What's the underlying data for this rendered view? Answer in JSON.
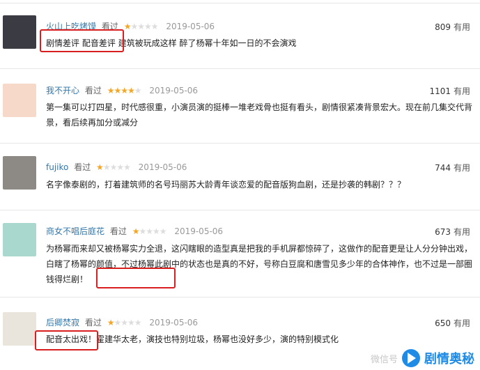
{
  "reviews": [
    {
      "user": "火山上吃烤馍",
      "watched": "看过",
      "stars": 1,
      "date": "2019-05-06",
      "votes": "809",
      "useful": "有用",
      "text": "剧情差评 配音差评 建筑被玩成这样 醉了杨幂十年如一日的不会演戏",
      "avatar_color": "#3b3b44"
    },
    {
      "user": "我不开心",
      "watched": "看过",
      "stars": 4,
      "date": "2019-05-06",
      "votes": "1101",
      "useful": "有用",
      "text": "第一集可以打四星，时代感很重，小演员演的挺棒一堆老戏骨也挺有看头，剧情很紧凑背景宏大。现在前几集交代背景，看后续再加分或减分",
      "avatar_color": "#f6d9c9"
    },
    {
      "user": "fujiko",
      "watched": "看过",
      "stars": 1,
      "date": "2019-05-06",
      "votes": "744",
      "useful": "有用",
      "text": "名字像泰剧的，打着建筑师的名号玛丽苏大龄青年谈恋爱的配音版狗血剧，还是抄袭的韩剧？？？",
      "avatar_color": "#8d8a86"
    },
    {
      "user": "商女不唱后庭花",
      "watched": "看过",
      "stars": 1,
      "date": "2019-05-06",
      "votes": "673",
      "useful": "有用",
      "text": "为杨幂而来却又被杨幂实力全退，这闪瞎眼的造型真是把我的手机屏都惊碎了，这做作的配音更是让人分分钟出戏，白瞎了杨幂的颜值，不过杨幂此剧中的状态也是真的不好，号称白豆腐和唐雪见多少年的合体神作，也不过是一部圈钱得烂剧！",
      "avatar_color": "#a9d8cf"
    },
    {
      "user": "后卿焚寂",
      "watched": "看过",
      "stars": 1,
      "date": "2019-05-06",
      "votes": "650",
      "useful": "有用",
      "text": "配音太出戏！霍建华太老，演技也特别垃圾，杨幂也没好多少，演的特别模式化",
      "avatar_color": "#e9e4dc"
    }
  ],
  "watermark": {
    "wechat": "微信号",
    "brand": "剧情奥秘"
  },
  "colors": {
    "highlight": "#d81e1e",
    "user_link": "#3377aa",
    "star": "#f5a623"
  }
}
